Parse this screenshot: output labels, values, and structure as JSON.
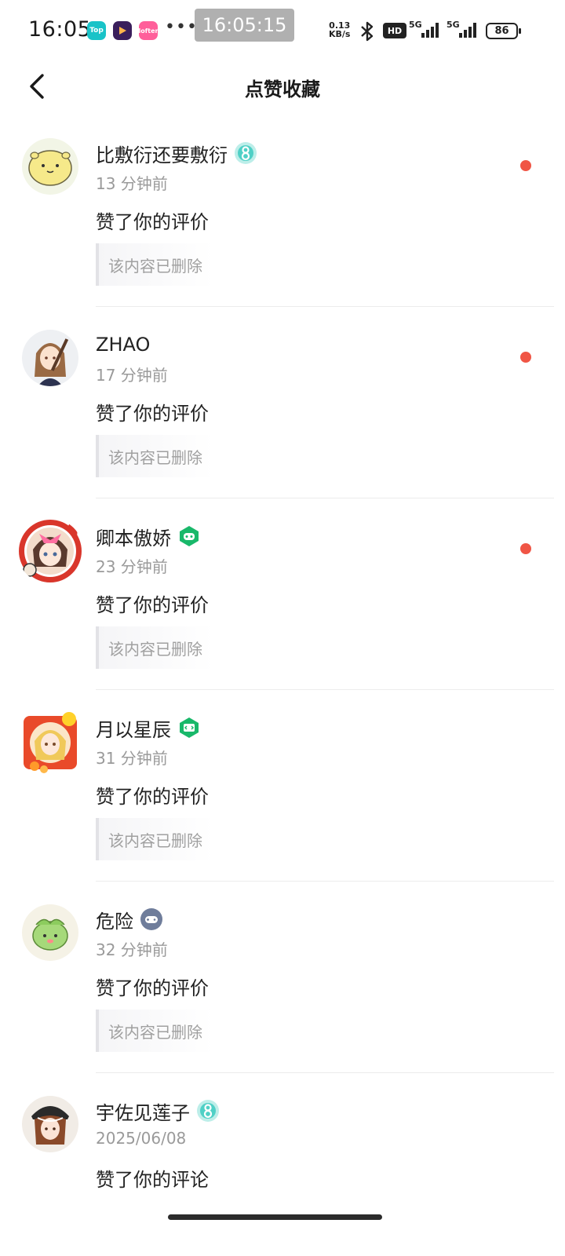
{
  "status_bar": {
    "time": "16:05",
    "apps": [
      "Top",
      "",
      "lofter"
    ],
    "more": "•••",
    "clock_overlay": "16:05:15",
    "net_speed_value": "0.13",
    "net_speed_unit": "KB/s",
    "hd": "HD",
    "sim1_label": "5G",
    "sim2_label": "5G",
    "battery": "86"
  },
  "header": {
    "title": "点赞收藏"
  },
  "notifications": [
    {
      "username": "比敷衍还要敷衍",
      "badge": "level-badge-icon",
      "time": "13 分钟前",
      "action": "赞了你的评价",
      "quote": "该内容已删除",
      "unread": true
    },
    {
      "username": "ZHAO",
      "badge": "",
      "time": "17 分钟前",
      "action": "赞了你的评价",
      "quote": "该内容已删除",
      "unread": true
    },
    {
      "username": "卿本傲娇",
      "badge": "game-badge-icon",
      "time": "23 分钟前",
      "action": "赞了你的评价",
      "quote": "该内容已删除",
      "unread": true
    },
    {
      "username": "月以星辰",
      "badge": "dev-badge-icon",
      "time": "31 分钟前",
      "action": "赞了你的评价",
      "quote": "该内容已删除",
      "unread": false
    },
    {
      "username": "危险",
      "badge": "controller-badge-icon",
      "time": "32 分钟前",
      "action": "赞了你的评价",
      "quote": "该内容已删除",
      "unread": false
    },
    {
      "username": "宇佐见莲子",
      "badge": "level-badge-icon",
      "time": "2025/06/08",
      "action": "赞了你的评论",
      "quote": "",
      "unread": false
    }
  ],
  "colors": {
    "unread_dot": "#f05545",
    "teal_badge": "#4fd0c6",
    "green_badge": "#19b86a",
    "slate_badge": "#6f7d9b"
  }
}
